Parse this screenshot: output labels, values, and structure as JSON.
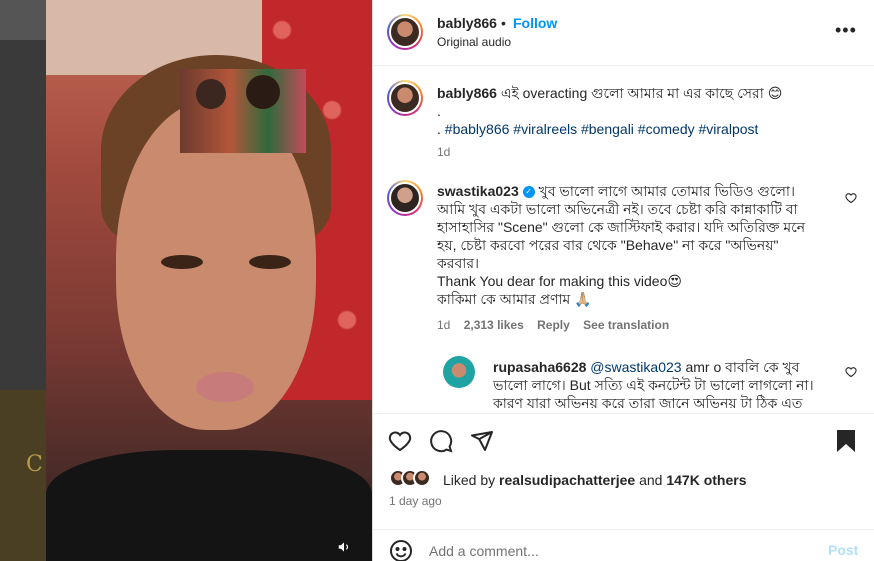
{
  "post": {
    "username": "bably866",
    "follow_label": "Follow",
    "separator": "•",
    "audio": "Original audio",
    "more": "•••"
  },
  "caption": {
    "username": "bably866",
    "text": "এই overacting গুলো আমার মা এর কাছে সেরা 😊",
    "dot": ".",
    "tags_prefix": ".",
    "tags": "#bably866 #viralreels #bengali #comedy #viralpost",
    "time": "1d"
  },
  "comments": [
    {
      "username": "swastika023",
      "verified": true,
      "lines": [
        "খুব ভালো লাগে আমার তোমার ভিডিও গুলো।",
        "আমি খুব একটা ভালো অভিনেত্রী নই। তবে চেষ্টা করি কান্নাকাটি বা",
        "হাসাহাসির \"Scene\" গুলো কে জাস্টিফাই করার। যদি অতিরিক্ত মনে",
        "হয়, চেষ্টা করবো পরের বার থেকে \"Behave\" না করে \"অভিনয়\"",
        "করবার।",
        "Thank You dear for making this video😍",
        "কাকিমা কে আমার প্রণাম 🙏🏼"
      ],
      "time": "1d",
      "likes": "2,313 likes",
      "reply": "Reply",
      "translate": "See translation"
    },
    {
      "username": "rupasaha6628",
      "mention": "@swastika023",
      "lines": [
        "amr o বাবলি কে খুব",
        "ভালো লাগে। But সত্যি এই কনটেন্ট টা ভালো লাগলো না।",
        "কারণ যারা অভিনয় করে তারা জানে অভিনয় টা ঠিক এত"
      ]
    }
  ],
  "actions": {
    "liked_by_prefix": "Liked by",
    "liked_by_user": "realsudipachatterjee",
    "liked_by_and": "and",
    "liked_by_others": "147K others",
    "time_ago": "1 day ago"
  },
  "comment_box": {
    "placeholder": "Add a comment...",
    "post_label": "Post"
  },
  "colors": {
    "link": "#0095f6",
    "hashtag": "#00376b",
    "muted": "#737373"
  },
  "icons": [
    "more-icon",
    "heart-icon",
    "comment-icon",
    "share-icon",
    "bookmark-icon",
    "emoji-icon",
    "speaker-icon",
    "verified-icon"
  ]
}
